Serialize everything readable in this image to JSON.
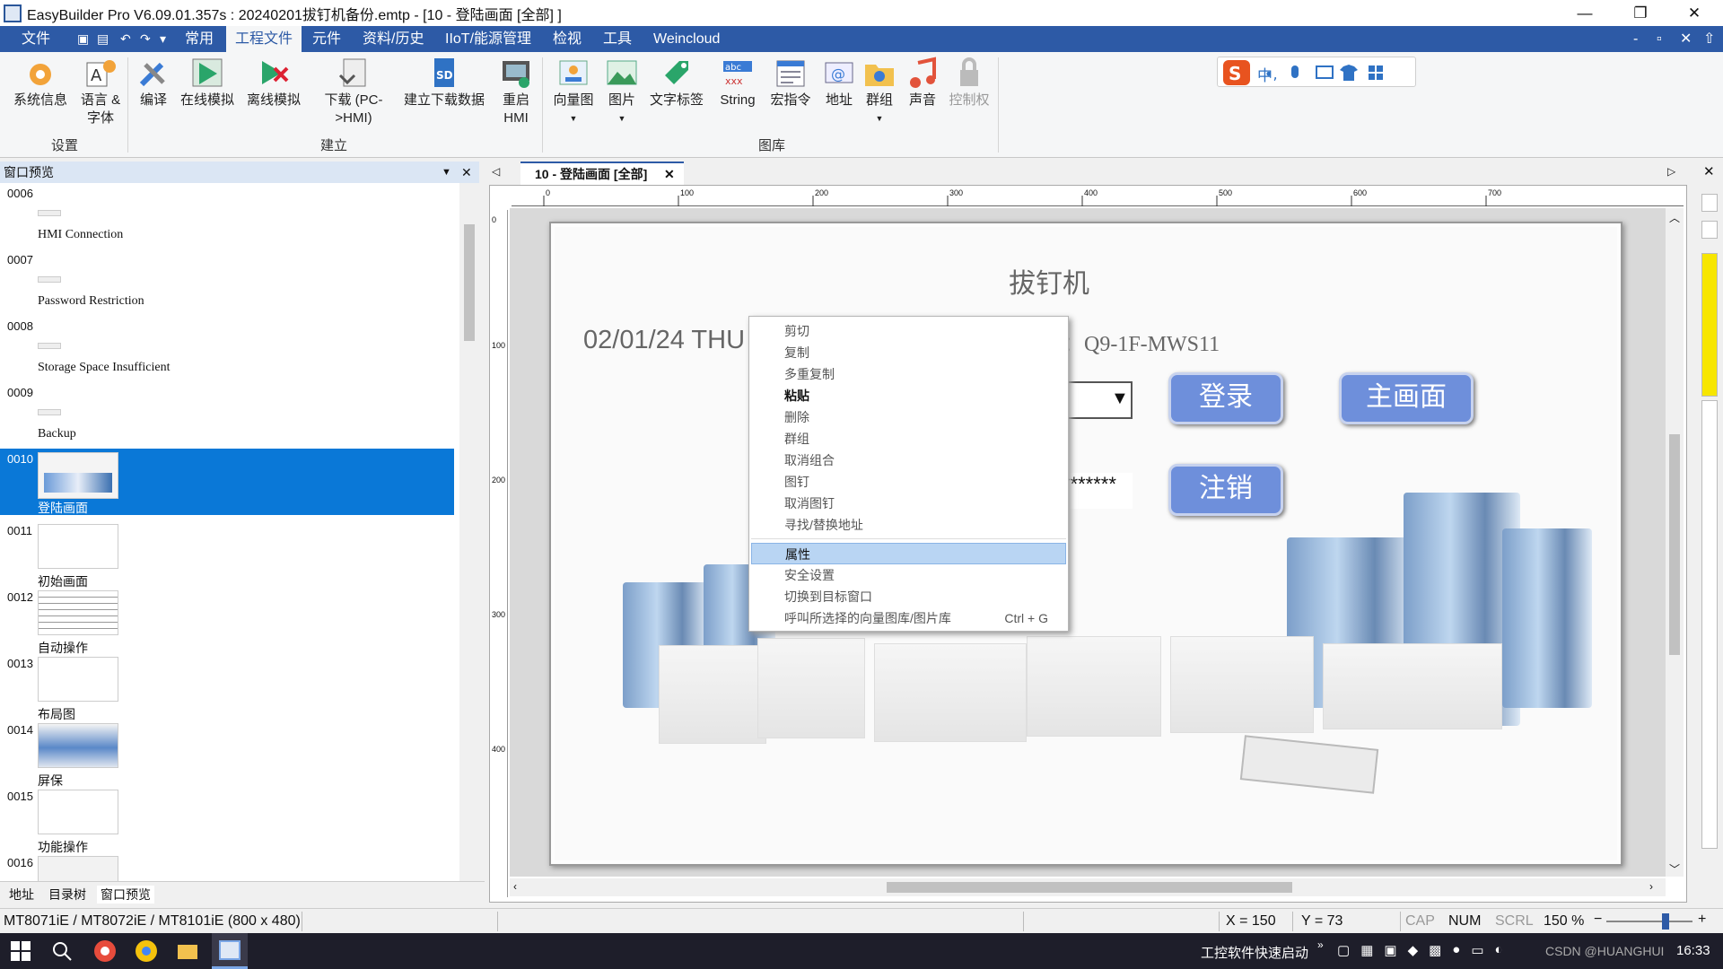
{
  "titlebar": {
    "title": "EasyBuilder Pro V6.09.01.357s : 20240201拔钉机备份.emtp - [10 - 登陆画面 [全部] ]",
    "minimize": "—",
    "restore": "❐",
    "close": "✕"
  },
  "menubar": {
    "items": [
      "文件",
      "常用",
      "工程文件",
      "元件",
      "资料/历史",
      "IIoT/能源管理",
      "检视",
      "工具",
      "Weincloud"
    ],
    "active": "工程文件",
    "right_controls": [
      "-",
      "▫",
      "✕",
      "⇧"
    ]
  },
  "ribbon": {
    "buttons": [
      "系统信息",
      "语言 &\n字体",
      "编译",
      "在线模拟",
      "离线模拟",
      "下载 (PC-\n>HMI)",
      "建立下载数据",
      "重启\nHMI",
      "向量图",
      "图片",
      "文字标签",
      "String",
      "宏指令",
      "地址",
      "群组",
      "声音",
      "控制权"
    ],
    "groups": [
      "设置",
      "建立",
      "图库"
    ],
    "ime_label": "中"
  },
  "left_panel": {
    "title": "窗口预览",
    "pages": [
      {
        "num": "0006",
        "name": "HMI Connection"
      },
      {
        "num": "0007",
        "name": "Password Restriction"
      },
      {
        "num": "0008",
        "name": "Storage Space Insufficient"
      },
      {
        "num": "0009",
        "name": "Backup"
      },
      {
        "num": "0010",
        "name": "登陆画面"
      },
      {
        "num": "0011",
        "name": "初始画面"
      },
      {
        "num": "0012",
        "name": "自动操作"
      },
      {
        "num": "0013",
        "name": "布局图"
      },
      {
        "num": "0014",
        "name": "屏保"
      },
      {
        "num": "0015",
        "name": "功能操作"
      },
      {
        "num": "0016",
        "name": ""
      }
    ],
    "selected": "0010",
    "tabs": [
      "地址",
      "目录树",
      "窗口预览"
    ],
    "active_tab": "窗口预览"
  },
  "document": {
    "tab_title": "10 - 登陆画面 [全部]",
    "ruler_marks": [
      "0",
      "100",
      "200",
      "300",
      "400",
      "500",
      "600",
      "700"
    ],
    "vruler_marks": [
      "0",
      "100",
      "200",
      "300",
      "400"
    ]
  },
  "hmi_screen": {
    "title": "拔钉机",
    "date": "02/01/24 THU",
    "station": "：Q9-1F-MWS11",
    "password": "*******",
    "buttons": {
      "login": "登录",
      "main": "主画面",
      "logout": "注销"
    }
  },
  "context_menu": {
    "items": [
      "剪切",
      "复制",
      "多重复制",
      "粘贴",
      "删除",
      "群组",
      "取消组合",
      "图钉",
      "取消图钉",
      "寻找/替换地址",
      "属性",
      "安全设置",
      "切换到目标窗口",
      "呼叫所选择的向量图库/图片库"
    ],
    "shortcut": "Ctrl + G",
    "highlighted": "属性"
  },
  "statusbar": {
    "model": "MT8071iE / MT8072iE / MT8101iE (800 x 480)",
    "x": "X = 150",
    "y": "Y = 73",
    "cap": "CAP",
    "num": "NUM",
    "scrl": "SCRL",
    "zoom": "150 %"
  },
  "taskbar": {
    "tray_text": "工控软件快速启动",
    "clock": "16:33",
    "watermark": "CSDN @HUANGHUI"
  },
  "colors": {
    "menubar": "#2d5aa6",
    "hmi_button": "#6e8fdb",
    "selection": "#0a78d7"
  }
}
